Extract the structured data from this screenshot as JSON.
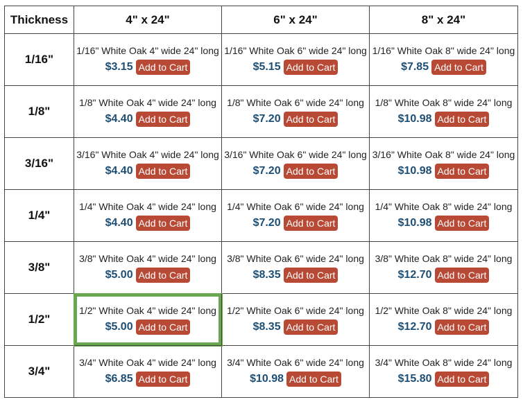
{
  "table": {
    "header": [
      "Thickness",
      "4\" x 24\"",
      "6\" x 24\"",
      "8\" x 24\""
    ],
    "button_label": "Add to Cart",
    "selected_color": "#6aa84f",
    "price_color": "#1d4f76",
    "button_color": "#b84a35",
    "rows": [
      {
        "thickness": "1/16\"",
        "cells": [
          {
            "desc": "1/16\" White Oak 4\" wide 24\" long",
            "price": "$3.15"
          },
          {
            "desc": "1/16\" White Oak 6\" wide 24\" long",
            "price": "$5.15"
          },
          {
            "desc": "1/16\" White Oak 8\" wide 24\" long",
            "price": "$7.85"
          }
        ]
      },
      {
        "thickness": "1/8\"",
        "cells": [
          {
            "desc": "1/8\" White Oak 4\" wide 24\" long",
            "price": "$4.40"
          },
          {
            "desc": "1/8\" White Oak 6\" wide 24\" long",
            "price": "$7.20"
          },
          {
            "desc": "1/8\" White Oak 8\" wide 24\" long",
            "price": "$10.98"
          }
        ]
      },
      {
        "thickness": "3/16\"",
        "cells": [
          {
            "desc": "3/16\" White Oak 4\" wide 24\" long",
            "price": "$4.40"
          },
          {
            "desc": "3/16\" White Oak 6\" wide 24\" long",
            "price": "$7.20"
          },
          {
            "desc": "3/16\" White Oak 8\" wide 24\" long",
            "price": "$10.98"
          }
        ]
      },
      {
        "thickness": "1/4\"",
        "cells": [
          {
            "desc": "1/4\" White Oak 4\" wide 24\" long",
            "price": "$4.40"
          },
          {
            "desc": "1/4\" White Oak 6\" wide 24\" long",
            "price": "$7.20"
          },
          {
            "desc": "1/4\" White Oak 8\" wide 24\" long",
            "price": "$10.98"
          }
        ]
      },
      {
        "thickness": "3/8\"",
        "cells": [
          {
            "desc": "3/8\" White Oak 4\" wide 24\" long",
            "price": "$5.00"
          },
          {
            "desc": "3/8\" White Oak 6\" wide 24\" long",
            "price": "$8.35"
          },
          {
            "desc": "3/8\" White Oak 8\" wide 24\" long",
            "price": "$12.70"
          }
        ]
      },
      {
        "thickness": "1/2\"",
        "cells": [
          {
            "desc": "1/2\" White Oak 4\" wide 24\" long",
            "price": "$5.00",
            "selected": true
          },
          {
            "desc": "1/2\" White Oak 6\" wide 24\" long",
            "price": "$8.35"
          },
          {
            "desc": "1/2\" White Oak 8\" wide 24\" long",
            "price": "$12.70"
          }
        ]
      },
      {
        "thickness": "3/4\"",
        "cells": [
          {
            "desc": "3/4\" White Oak 4\" wide 24\" long",
            "price": "$6.85"
          },
          {
            "desc": "3/4\" White Oak 6\" wide 24\" long",
            "price": "$10.98"
          },
          {
            "desc": "3/4\" White Oak 8\" wide 24\" long",
            "price": "$15.80"
          }
        ]
      }
    ]
  }
}
